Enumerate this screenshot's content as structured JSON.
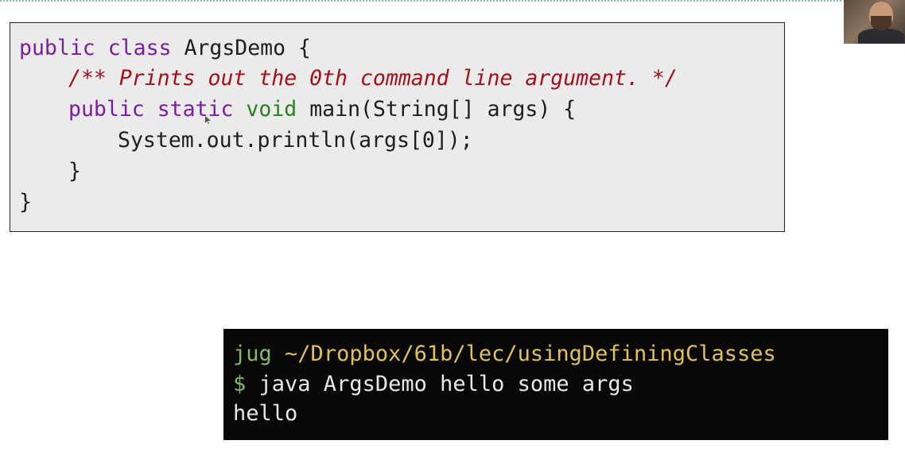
{
  "code": {
    "line1": {
      "kw1": "public",
      "kw2": "class",
      "rest": "ArgsDemo {"
    },
    "line2": {
      "comment": "/** Prints out the 0th command line argument. */"
    },
    "line3": {
      "kw1": "public",
      "kw2": "static",
      "kw3": "void",
      "rest": "main(String[] args) {"
    },
    "line4": {
      "text": "System.out.println(args[0]);"
    },
    "line5": {
      "text": "}"
    },
    "line6": {
      "text": "}"
    }
  },
  "terminal": {
    "user": "jug",
    "path": "~/Dropbox/61b/lec/usingDefiningClasses",
    "prompt": "$",
    "command": "java ArgsDemo hello some args",
    "output": "hello"
  },
  "colors": {
    "keyword": "#7a1f9e",
    "type_keyword": "#2d7d24",
    "comment": "#a0111c",
    "terminal_user": "#8ab86a",
    "terminal_path": "#e0c15e"
  }
}
